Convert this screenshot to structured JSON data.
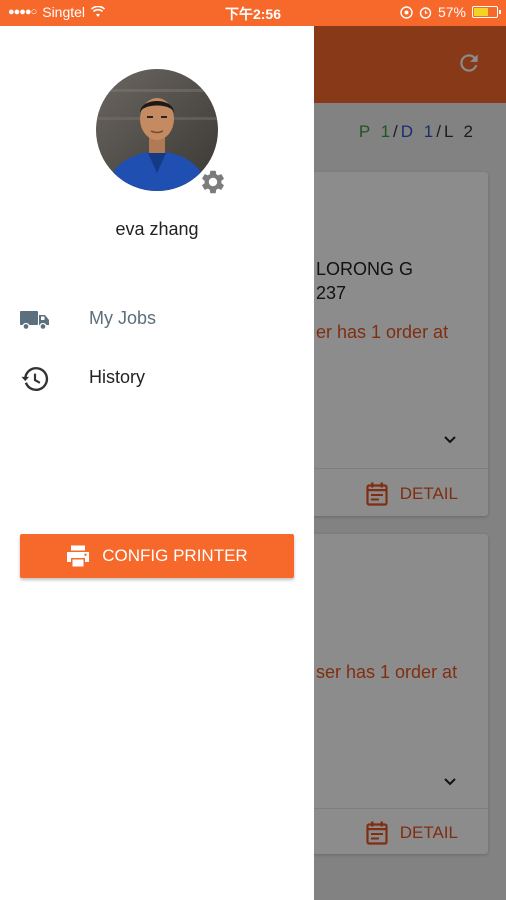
{
  "status_bar": {
    "signal_dots": "●●●●○",
    "carrier": "Singtel",
    "time": "下午2:56",
    "battery_percent": "57%",
    "battery_level": 0.57
  },
  "toolbar": {
    "color": "#f7682b",
    "refresh_icon": "refresh-icon"
  },
  "counters": {
    "p": "P 1",
    "d": "D 1",
    "l": "L 2"
  },
  "cards": [
    {
      "address_line1": "LORONG G",
      "address_line2": "237",
      "warning": "er has 1 order at",
      "detail_label": "DETAIL"
    },
    {
      "warning": "ser has 1 order at",
      "detail_label": "DETAIL"
    }
  ],
  "drawer": {
    "username": "eva zhang",
    "avatar_icon": "user-avatar",
    "settings_icon": "gear-icon",
    "nav_items": [
      {
        "label": "My Jobs",
        "icon": "truck-icon"
      },
      {
        "label": "History",
        "icon": "history-icon"
      }
    ],
    "config_printer_label": "CONFIG PRINTER",
    "config_printer_icon": "printer-icon"
  },
  "colors": {
    "accent": "#f7682b",
    "warning_text": "#e8551f",
    "nav_active": "#5b6f7d"
  }
}
